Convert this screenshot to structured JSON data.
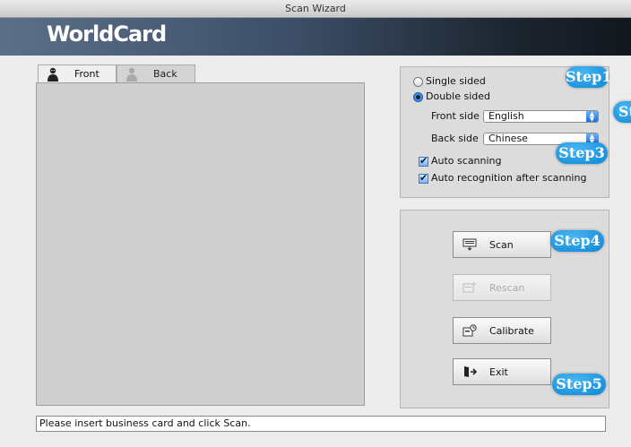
{
  "window": {
    "title": "Scan Wizard"
  },
  "brand": {
    "logo_text": "WorldCard"
  },
  "tabs": [
    {
      "label": "Front",
      "icon": "person-dark-icon",
      "selected": true
    },
    {
      "label": "Back",
      "icon": "person-light-icon",
      "selected": false
    }
  ],
  "options": {
    "single_sided": "Single sided",
    "double_sided": "Double sided",
    "selected_mode": "Double sided",
    "front_side_label": "Front side",
    "front_side_value": "English",
    "back_side_label": "Back side",
    "back_side_value": "Chinese",
    "auto_scanning": "Auto scanning",
    "auto_scanning_checked": true,
    "auto_recognition": "Auto recognition after scanning",
    "auto_recognition_checked": true
  },
  "buttons": {
    "scan": "Scan",
    "rescan": "Rescan",
    "calibrate": "Calibrate",
    "exit": "Exit"
  },
  "steps": [
    "Step1",
    "St",
    "Step3",
    "Step4",
    "Step5"
  ],
  "status": {
    "message": "Please insert business card and click Scan."
  },
  "colors": {
    "step_badge": "#0b86d6",
    "banner_dark": "#12171d",
    "banner_light": "#5b6f89"
  }
}
